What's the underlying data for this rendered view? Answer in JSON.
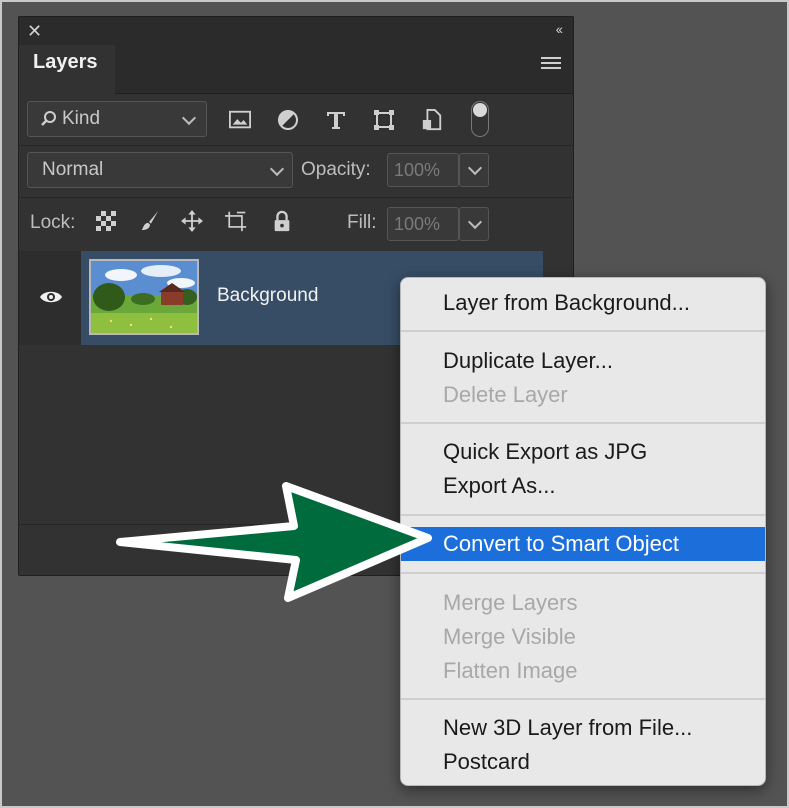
{
  "panel": {
    "close_glyph": "✕",
    "collapse_glyph": "‹‹",
    "tab_label": "Layers",
    "menu_icon": "hamburger-icon",
    "filter": {
      "kind_label": "Kind",
      "icons": [
        "image-filter-icon",
        "adjustment-filter-icon",
        "type-filter-icon",
        "shape-filter-icon",
        "smart-object-filter-icon"
      ]
    },
    "blend_mode": "Normal",
    "opacity_label": "Opacity:",
    "opacity_value": "100%",
    "lock_label": "Lock:",
    "lock_icons": [
      "lock-transparent-icon",
      "lock-image-icon",
      "lock-position-icon",
      "artboard-icon",
      "lock-all-icon"
    ],
    "fill_label": "Fill:",
    "fill_value": "100%",
    "layer": {
      "name": "Background",
      "visible_icon": "eye-icon"
    }
  },
  "context_menu": {
    "items": [
      {
        "label": "Layer from Background...",
        "enabled": true
      },
      {
        "label": "Duplicate Layer...",
        "enabled": true
      },
      {
        "label": "Delete Layer",
        "enabled": false
      },
      {
        "label": "Quick Export as JPG",
        "enabled": true
      },
      {
        "label": "Export As...",
        "enabled": true
      },
      {
        "label": "Convert to Smart Object",
        "enabled": true,
        "highlighted": true
      },
      {
        "label": "Merge Layers",
        "enabled": false
      },
      {
        "label": "Merge Visible",
        "enabled": false
      },
      {
        "label": "Flatten Image",
        "enabled": false
      },
      {
        "label": "New 3D Layer from File...",
        "enabled": true
      },
      {
        "label": "Postcard",
        "enabled": true
      }
    ]
  },
  "colors": {
    "highlight": "#1c6fdb",
    "arrow_fill": "#006b3c",
    "selected_layer": "#374d66"
  }
}
